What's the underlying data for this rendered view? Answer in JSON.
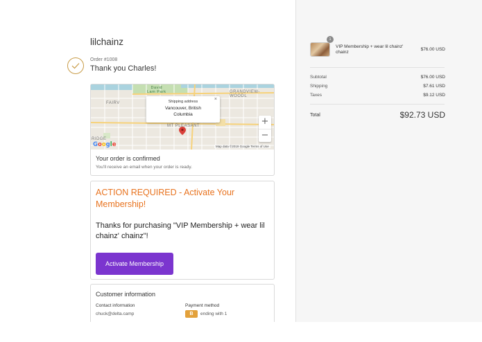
{
  "shop": {
    "name": "lilchainz"
  },
  "order": {
    "number": "Order #1008",
    "thanks": "Thank you Charles!"
  },
  "map": {
    "labels": {
      "david_lam_park": "David\nLam Park",
      "grandview": "GRANDVIEW-WOODL",
      "fairview": "FAIRV",
      "mt_pleasant": "MT PLEASANT",
      "ridge": "RIDGE"
    },
    "popup": {
      "title": "Shipping address",
      "address_line1": "Vancouver, British",
      "address_line2": "Columbia",
      "close": "×"
    },
    "zoom_in": "+",
    "zoom_out": "−",
    "google": "Google",
    "footer": "Map data ©2019 Google    Terms of Use"
  },
  "confirmation": {
    "title": "Your order is confirmed",
    "subtitle": "You'll receive an email when your order is ready."
  },
  "action": {
    "title": "ACTION REQUIRED - Activate Your Membership!",
    "body": "Thanks for purchasing \"VIP Membership + wear lil chainz' chainz\"!",
    "button": "Activate Membership"
  },
  "customer": {
    "title": "Customer information",
    "contact_heading": "Contact information",
    "contact_value": "chuck@delta.camp",
    "payment_heading": "Payment method",
    "payment_badge": "B",
    "payment_value": "ending with 1"
  },
  "summary": {
    "item": {
      "quantity": "1",
      "name": "VIP Membership + wear lil chainz' chainz",
      "price": "$76.00 USD"
    },
    "subtotal_label": "Subtotal",
    "subtotal": "$76.00 USD",
    "shipping_label": "Shipping",
    "shipping": "$7.61 USD",
    "taxes_label": "Taxes",
    "taxes": "$9.12 USD",
    "total_label": "Total",
    "total": "$92.73 USD"
  },
  "colors": {
    "accent_orange": "#e8731f",
    "button_purple": "#7b35cf",
    "check_gold": "#c89b46",
    "sidebar_bg": "#f6f6f6"
  }
}
